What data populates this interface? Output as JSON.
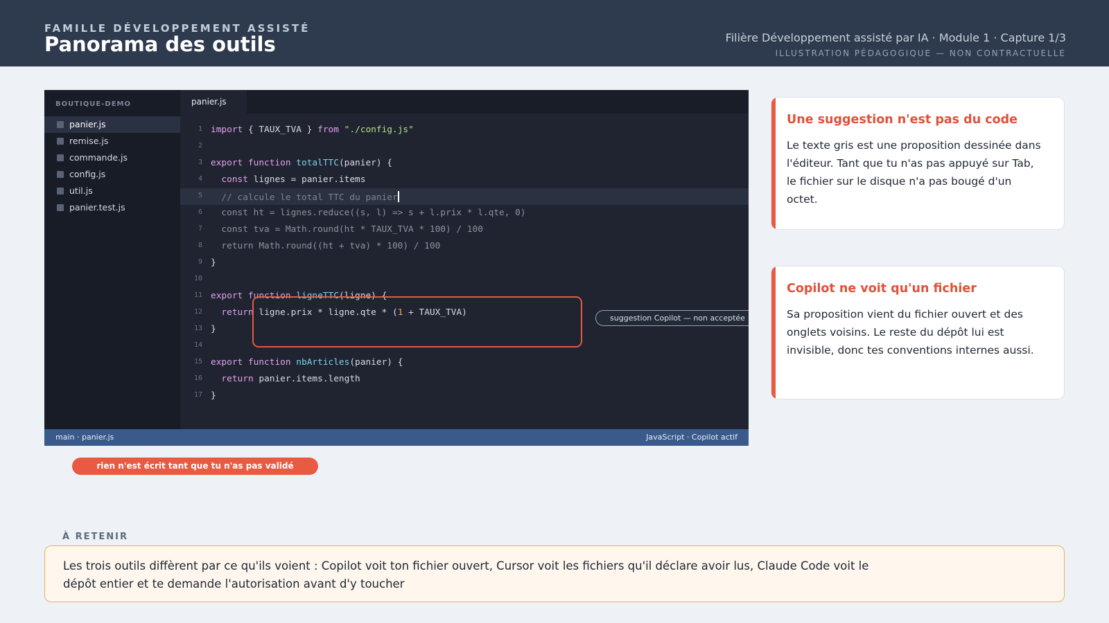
{
  "header": {
    "kicker": "FAMILLE DÉVELOPPEMENT ASSISTÉ",
    "title": "Panorama des outils",
    "meta": "Filière Développement assisté par IA · Module 1 · Capture 1/3",
    "disclaimer": "ILLUSTRATION PÉDAGOGIQUE — NON CONTRACTUELLE"
  },
  "editor": {
    "project_name": "BOUTIQUE-DEMO",
    "files": [
      "panier.js",
      "remise.js",
      "commande.js",
      "config.js",
      "util.js",
      "panier.test.js"
    ],
    "active_file": "panier.js",
    "tab_label": "panier.js",
    "line_numbers": [
      "1",
      "2",
      "3",
      "4",
      "5",
      "6",
      "7",
      "8",
      "9",
      "10",
      "11",
      "12",
      "13",
      "14",
      "15",
      "16",
      "17"
    ],
    "suggestion_label": "suggestion Copilot — non acceptée",
    "status_left": "main · panier.js",
    "status_right": "JavaScript · Copilot actif"
  },
  "warning_pill": "rien n'est écrit tant que tu n'as pas validé",
  "cards": [
    {
      "title": "Une suggestion n'est pas du code",
      "body": "Le texte gris est une proposition dessinée dans l'éditeur. Tant que tu n'as pas appuyé sur Tab, le fichier sur le disque n'a pas bougé d'un octet."
    },
    {
      "title": "Copilot ne voit qu'un fichier",
      "body": "Sa proposition vient du fichier ouvert et des onglets voisins. Le reste du dépôt lui est invisible, donc tes conventions internes aussi."
    }
  ],
  "retain": {
    "label": "À RETENIR",
    "text": "Les trois outils diffèrent par ce qu'ils voient : Copilot voit ton fichier ouvert, Cursor voit les fichiers qu'il déclare avoir lus, Claude Code voit le dépôt entier et te demande l'autorisation avant d'y toucher"
  },
  "colors": {
    "accent": "#e85a42",
    "header_bg": "#2e3a4d",
    "editor_bg": "#1f2430",
    "statusbar_bg": "#3a5a8c",
    "retain_border": "#e7b257"
  }
}
